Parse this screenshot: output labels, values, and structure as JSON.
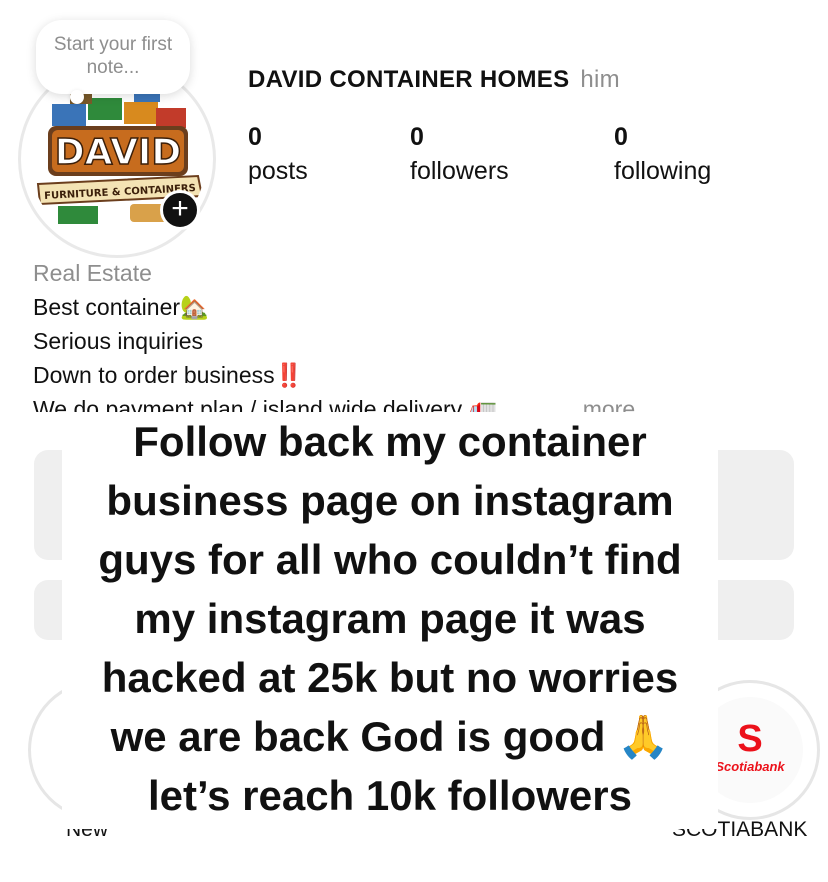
{
  "note": {
    "text": "Start your first note..."
  },
  "profile": {
    "name": "DAVID CONTAINER HOMES",
    "pronoun": "him",
    "logo": {
      "brand": "DAVID",
      "tagline": "FURNITURE & CONTAINERS"
    },
    "add_icon": "+"
  },
  "stats": [
    {
      "value": "0",
      "label": "posts"
    },
    {
      "value": "0",
      "label": "followers"
    },
    {
      "value": "0",
      "label": "following"
    }
  ],
  "bio": {
    "category": "Real Estate",
    "line1": "Best container🏡",
    "line2": "Serious inquiries",
    "line3": "Down to order business‼️",
    "line4": "We do payment plan / island wide delivery 🚛",
    "more": "... more"
  },
  "highlights": [
    {
      "label": "New"
    },
    {
      "label": "SCOTIABANK",
      "cover_symbol": "S",
      "cover_text": "Scotiabank"
    }
  ],
  "caption": "Follow back my container business page on instagram guys for all who couldn’t find my instagram page it was hacked at 25k but no worries we are back God is good 🙏 let’s reach 10k followers",
  "colors": {
    "accent_red": "#ec111a",
    "muted_text": "#8e8e8e",
    "button_bg": "#efefef"
  }
}
